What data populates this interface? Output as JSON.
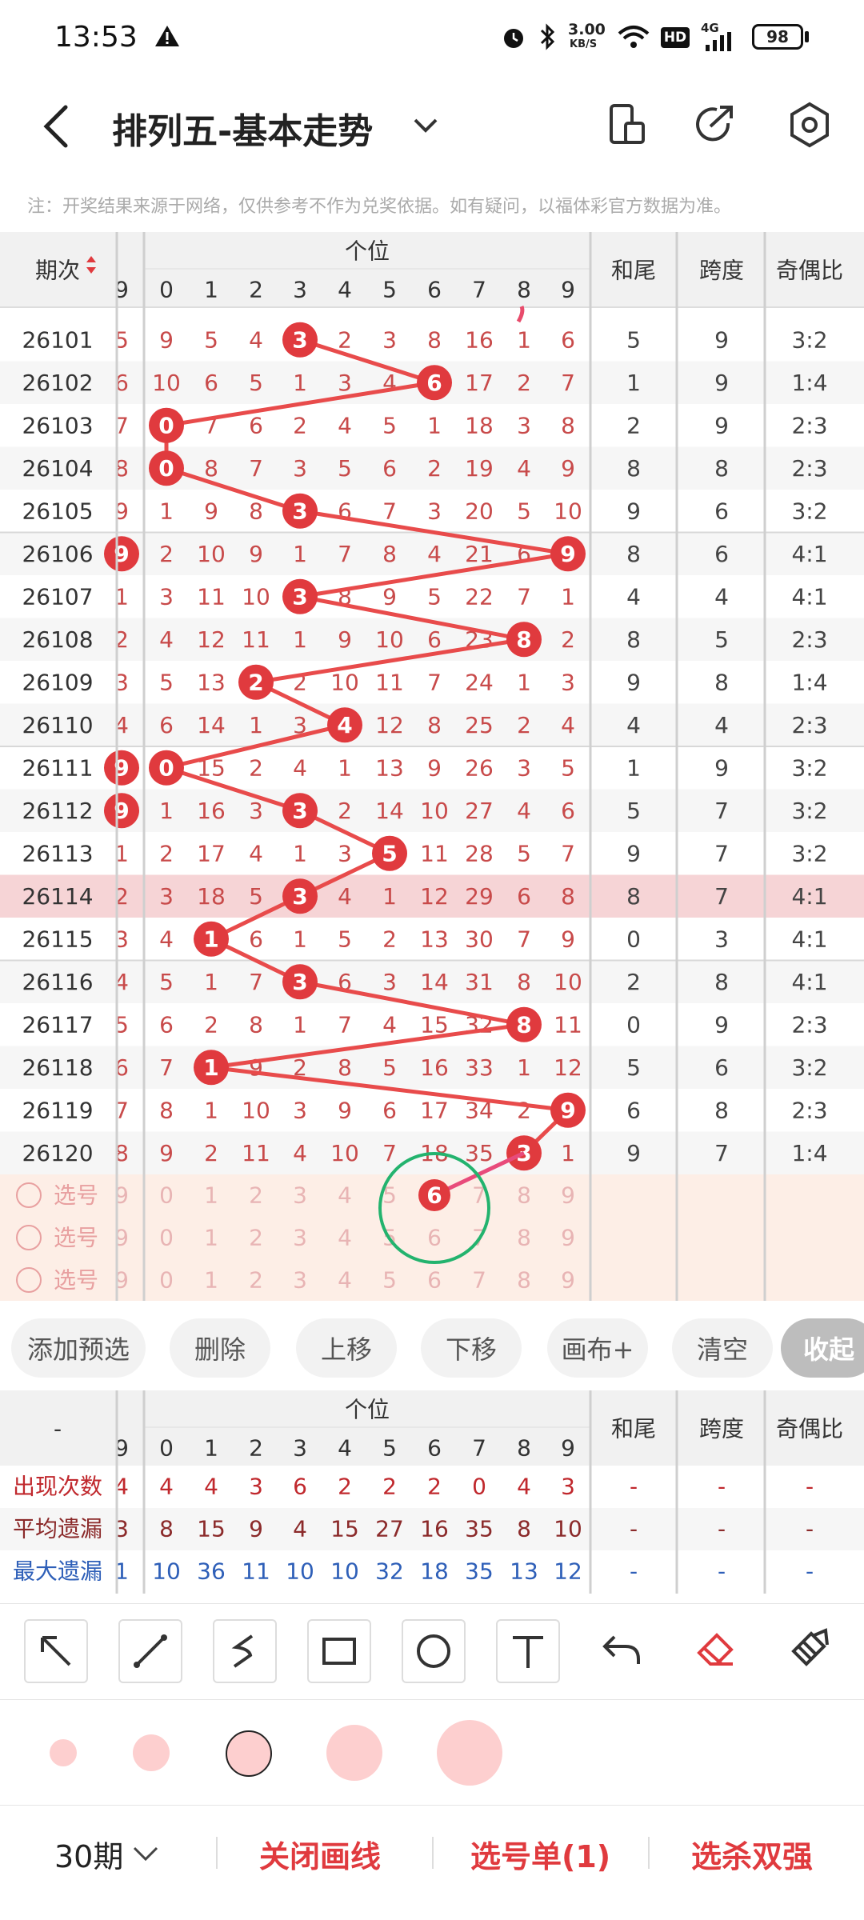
{
  "status": {
    "time": "13:53",
    "net_speed_top": "3.00",
    "net_speed_unit": "KB/S",
    "hd": "HD",
    "signal": "4G",
    "battery": "98"
  },
  "header": {
    "title": "排列五-基本走势"
  },
  "notice": "注：开奖结果来源于网络，仅供参考不作为兑奖依据。如有疑问，以福体彩官方数据为准。",
  "table": {
    "col_issue": "期次",
    "group_label": "个位",
    "digits": [
      "9",
      "0",
      "1",
      "2",
      "3",
      "4",
      "5",
      "6",
      "7",
      "8",
      "9"
    ],
    "extra_cols": [
      "和尾",
      "跨度",
      "奇偶比"
    ],
    "rows": [
      {
        "issue": "26101",
        "cells": [
          "5",
          "9",
          "5",
          "4",
          "3",
          "2",
          "3",
          "8",
          "16",
          "1",
          "6"
        ],
        "hit": 4,
        "sum": "5",
        "span": "9",
        "ratio": "3:2"
      },
      {
        "issue": "26102",
        "cells": [
          "6",
          "10",
          "6",
          "5",
          "1",
          "3",
          "4",
          "6",
          "17",
          "2",
          "7"
        ],
        "hit": 7,
        "sum": "1",
        "span": "9",
        "ratio": "1:4"
      },
      {
        "issue": "26103",
        "cells": [
          "7",
          "0",
          "7",
          "6",
          "2",
          "4",
          "5",
          "1",
          "18",
          "3",
          "8"
        ],
        "hit": 1,
        "sum": "2",
        "span": "9",
        "ratio": "2:3"
      },
      {
        "issue": "26104",
        "cells": [
          "8",
          "0",
          "8",
          "7",
          "3",
          "5",
          "6",
          "2",
          "19",
          "4",
          "9"
        ],
        "hit": 1,
        "sum": "8",
        "span": "8",
        "ratio": "2:3"
      },
      {
        "issue": "26105",
        "cells": [
          "9",
          "1",
          "9",
          "8",
          "3",
          "6",
          "7",
          "3",
          "20",
          "5",
          "10"
        ],
        "hit": 4,
        "sum": "9",
        "span": "6",
        "ratio": "3:2"
      },
      {
        "issue": "26106",
        "cells": [
          "9",
          "2",
          "10",
          "9",
          "1",
          "7",
          "8",
          "4",
          "21",
          "6",
          "9"
        ],
        "hit": 10,
        "hitL": true,
        "sum": "8",
        "span": "6",
        "ratio": "4:1"
      },
      {
        "issue": "26107",
        "cells": [
          "1",
          "3",
          "11",
          "10",
          "3",
          "8",
          "9",
          "5",
          "22",
          "7",
          "1"
        ],
        "hit": 4,
        "sum": "4",
        "span": "4",
        "ratio": "4:1"
      },
      {
        "issue": "26108",
        "cells": [
          "2",
          "4",
          "12",
          "11",
          "1",
          "9",
          "10",
          "6",
          "23",
          "8",
          "2"
        ],
        "hit": 9,
        "sum": "8",
        "span": "5",
        "ratio": "2:3"
      },
      {
        "issue": "26109",
        "cells": [
          "3",
          "5",
          "13",
          "2",
          "2",
          "10",
          "11",
          "7",
          "24",
          "1",
          "3"
        ],
        "hit": 3,
        "sum": "9",
        "span": "8",
        "ratio": "1:4"
      },
      {
        "issue": "26110",
        "cells": [
          "4",
          "6",
          "14",
          "1",
          "3",
          "4",
          "12",
          "8",
          "25",
          "2",
          "4"
        ],
        "hit": 5,
        "sum": "4",
        "span": "4",
        "ratio": "2:3"
      },
      {
        "issue": "26111",
        "cells": [
          "9",
          "0",
          "15",
          "2",
          "4",
          "1",
          "13",
          "9",
          "26",
          "3",
          "5"
        ],
        "hit": 1,
        "hitL": true,
        "sum": "1",
        "span": "9",
        "ratio": "3:2"
      },
      {
        "issue": "26112",
        "cells": [
          "9",
          "1",
          "16",
          "3",
          "3",
          "2",
          "14",
          "10",
          "27",
          "4",
          "6"
        ],
        "hit": 4,
        "hitL": true,
        "sum": "5",
        "span": "7",
        "ratio": "3:2"
      },
      {
        "issue": "26113",
        "cells": [
          "1",
          "2",
          "17",
          "4",
          "1",
          "3",
          "5",
          "11",
          "28",
          "5",
          "7"
        ],
        "hit": 6,
        "sum": "9",
        "span": "7",
        "ratio": "3:2"
      },
      {
        "issue": "26114",
        "cells": [
          "2",
          "3",
          "18",
          "5",
          "3",
          "4",
          "1",
          "12",
          "29",
          "6",
          "8"
        ],
        "hit": 4,
        "sum": "8",
        "span": "7",
        "ratio": "4:1"
      },
      {
        "issue": "26115",
        "cells": [
          "3",
          "4",
          "1",
          "6",
          "1",
          "5",
          "2",
          "13",
          "30",
          "7",
          "9"
        ],
        "hit": 2,
        "sum": "0",
        "span": "3",
        "ratio": "4:1"
      },
      {
        "issue": "26116",
        "cells": [
          "4",
          "5",
          "1",
          "7",
          "3",
          "6",
          "3",
          "14",
          "31",
          "8",
          "10"
        ],
        "hit": 4,
        "sum": "2",
        "span": "8",
        "ratio": "4:1"
      },
      {
        "issue": "26117",
        "cells": [
          "5",
          "6",
          "2",
          "8",
          "1",
          "7",
          "4",
          "15",
          "32",
          "8",
          "11"
        ],
        "hit": 9,
        "sum": "0",
        "span": "9",
        "ratio": "2:3"
      },
      {
        "issue": "26118",
        "cells": [
          "6",
          "7",
          "1",
          "9",
          "2",
          "8",
          "5",
          "16",
          "33",
          "1",
          "12"
        ],
        "hit": 2,
        "sum": "5",
        "span": "6",
        "ratio": "3:2"
      },
      {
        "issue": "26119",
        "cells": [
          "7",
          "8",
          "1",
          "10",
          "3",
          "9",
          "6",
          "17",
          "34",
          "2",
          "9"
        ],
        "hit": 10,
        "sum": "6",
        "span": "8",
        "ratio": "2:3"
      },
      {
        "issue": "26120",
        "cells": [
          "8",
          "9",
          "2",
          "11",
          "4",
          "10",
          "7",
          "18",
          "35",
          "3",
          "1"
        ],
        "hit": 9,
        "sum": "9",
        "span": "7",
        "ratio": "1:4"
      }
    ],
    "select_label": "选号",
    "select_digits": [
      "9",
      "0",
      "1",
      "2",
      "3",
      "4",
      "5",
      "6",
      "7",
      "8",
      "9"
    ]
  },
  "actions": [
    "添加预选",
    "删除",
    "上移",
    "下移",
    "画布+",
    "清空",
    "收起"
  ],
  "stats": {
    "dash": "-",
    "rows": [
      {
        "label": "出现次数",
        "cells": [
          "4",
          "4",
          "4",
          "3",
          "6",
          "2",
          "2",
          "2",
          "0",
          "4",
          "3"
        ],
        "extra": [
          "-",
          "-",
          "-"
        ]
      },
      {
        "label": "平均遗漏",
        "cells": [
          "3",
          "8",
          "15",
          "9",
          "4",
          "15",
          "27",
          "16",
          "35",
          "8",
          "10"
        ],
        "extra": [
          "-",
          "-",
          "-"
        ]
      },
      {
        "label": "最大遗漏",
        "cells": [
          "1",
          "10",
          "36",
          "11",
          "10",
          "10",
          "32",
          "18",
          "35",
          "13",
          "12"
        ],
        "extra": [
          "-",
          "-",
          "-"
        ]
      }
    ]
  },
  "bottom": {
    "period": "30期",
    "close_line": "关闭画线",
    "select_list": "选号单(1)",
    "kill": "选杀双强"
  },
  "colors": {
    "accent": "#e03a3e",
    "line": "#e84b4b",
    "bg_pink": "#fdeee6",
    "stats_blue": "#2e5fb8"
  }
}
